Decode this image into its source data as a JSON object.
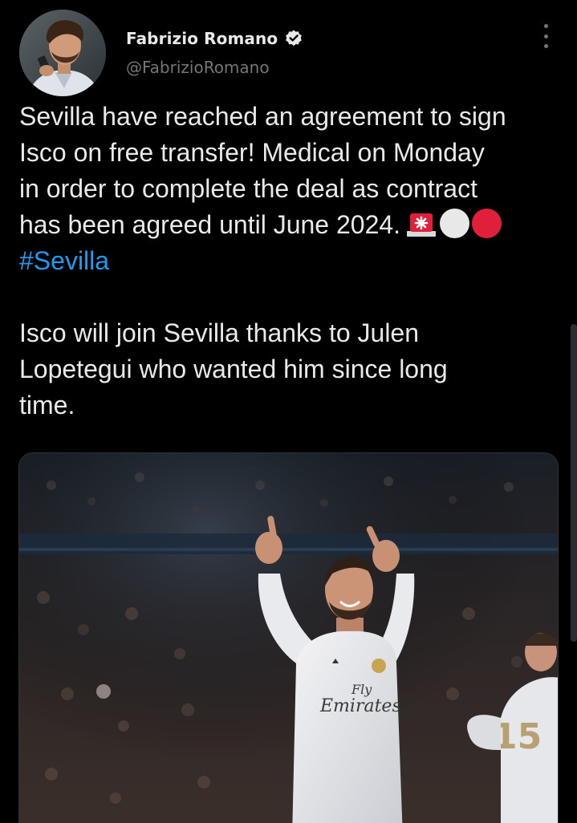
{
  "author": {
    "name": "Fabrizio Romano",
    "handle": "@FabrizioRomano",
    "verified": true
  },
  "tweet": {
    "line1": "Sevilla have reached an agreement to sign",
    "line2": "Isco on free transfer! Medical on Monday",
    "line3": "in order to complete the deal as contract",
    "line4": "has been agreed until June 2024.",
    "hashtag": "#Sevilla",
    "p2_line1": "Isco will join Sevilla thanks to Julen",
    "p2_line2": "Lopetegui who wanted him since long",
    "p2_line3": "time."
  },
  "media": {
    "shirt_text_1": "Fly",
    "shirt_text_2": "Emirates",
    "number": "15"
  },
  "colors": {
    "background": "#000000",
    "text": "#e7e9ea",
    "secondary": "#71767b",
    "link": "#1d9bf0",
    "red": "#e0203a"
  },
  "icons": [
    "verified-badge-icon",
    "more-options-icon",
    "rotating-light-emoji",
    "white-circle-emoji",
    "red-circle-emoji"
  ]
}
